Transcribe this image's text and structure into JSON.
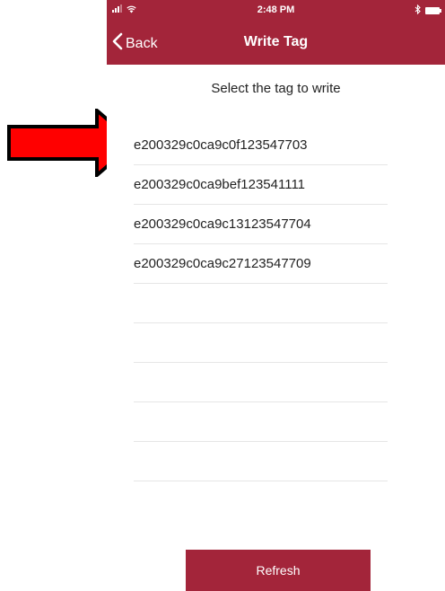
{
  "status_bar": {
    "time": "2:48 PM"
  },
  "nav": {
    "back_label": "Back",
    "title": "Write Tag"
  },
  "instruction": "Select the tag to write",
  "tags": [
    "e200329c0ca9c0f123547703",
    "e200329c0ca9bef123541111",
    "e200329c0ca9c13123547704",
    "e200329c0ca9c27123547709",
    "",
    "",
    "",
    "",
    ""
  ],
  "refresh_label": "Refresh",
  "colors": {
    "accent": "#a3253a",
    "annotation_arrow": "#ff0000"
  },
  "icons": {
    "back": "chevron-left-icon",
    "signal": "cellular-signal-icon",
    "wifi": "wifi-icon",
    "bluetooth": "bluetooth-icon",
    "battery": "battery-icon",
    "annotation": "red-arrow-icon"
  }
}
